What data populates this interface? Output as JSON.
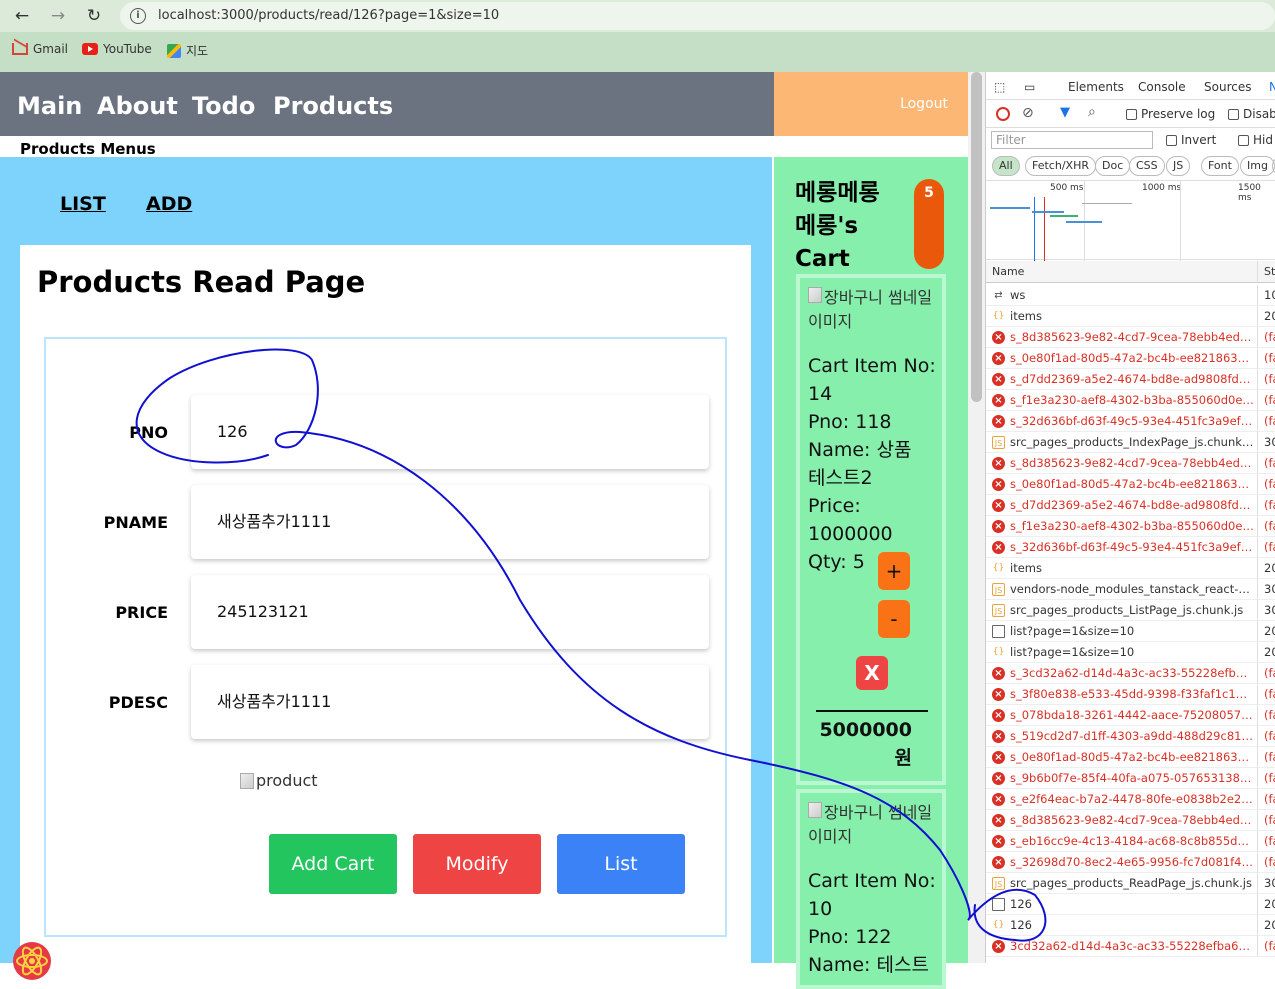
{
  "browser": {
    "url": "localhost:3000/products/read/126?page=1&size=10",
    "bookmarks": [
      "Gmail",
      "YouTube",
      "지도"
    ]
  },
  "app": {
    "nav": [
      "Main",
      "About",
      "Todo",
      "Products"
    ],
    "logout": "Logout",
    "menu_title": "Products Menus",
    "tabs": [
      "LIST",
      "ADD"
    ],
    "page_title": "Products Read Page",
    "fields": [
      {
        "label": "PNO",
        "value": "126"
      },
      {
        "label": "PNAME",
        "value": "새상품추가1111"
      },
      {
        "label": "PRICE",
        "value": "245123121"
      },
      {
        "label": "PDESC",
        "value": "새상품추가1111"
      }
    ],
    "product_image_alt": "product",
    "buttons": {
      "add_cart": "Add Cart",
      "modify": "Modify",
      "list": "List"
    }
  },
  "cart": {
    "title": "메롱메롱메롱's Cart",
    "count": "5",
    "items": [
      {
        "image_alt": "장바구니 썸네일 이미지",
        "cino_label": "Cart Item No:",
        "cino": "14",
        "pno": "Pno: 118",
        "name_label": "Name: 상품",
        "name_rest": "테스트2",
        "price_label": "Price:",
        "price": "1000000",
        "qty": "Qty: 5",
        "plus": "+",
        "minus": "-",
        "remove": "X",
        "total": "5000000",
        "currency": "원"
      },
      {
        "image_alt": "장바구니 썸네일 이미지",
        "cino_label": "Cart Item No:",
        "cino": "10",
        "pno": "Pno: 122",
        "name_label": "Name: 테스트"
      }
    ]
  },
  "devtools": {
    "tabs": [
      "Elements",
      "Console",
      "Sources",
      "N"
    ],
    "preserve_log": "Preserve log",
    "disable": "Disab",
    "filter_placeholder": "Filter",
    "invert": "Invert",
    "hide": "Hid",
    "filters": [
      "All",
      "Fetch/XHR",
      "Doc",
      "CSS",
      "JS",
      "Font",
      "Img",
      "M"
    ],
    "timeline_labels": [
      "500 ms",
      "1000 ms",
      "1500 ms"
    ],
    "col_name": "Name",
    "col_status": "Sta",
    "rows": [
      {
        "type": "ws",
        "name": "ws",
        "status": "10"
      },
      {
        "type": "xhr",
        "name": "items",
        "status": "20"
      },
      {
        "type": "err",
        "name": "s_8d385623-9e82-4cd7-9cea-78ebb4ed1ef5...",
        "status": "(fa"
      },
      {
        "type": "err",
        "name": "s_0e80f1ad-80d5-47a2-bc4b-ee8218639624...",
        "status": "(fa"
      },
      {
        "type": "err",
        "name": "s_d7dd2369-a5e2-4674-bd8e-ad9808fd0f87...",
        "status": "(fa"
      },
      {
        "type": "err",
        "name": "s_f1e3a230-aef8-4302-b3ba-855060d0e709...",
        "status": "(fa"
      },
      {
        "type": "err",
        "name": "s_32d636bf-d63f-49c5-93e4-451fc3a9efc1_l...",
        "status": "(fa"
      },
      {
        "type": "js",
        "name": "src_pages_products_IndexPage_js.chunk.js",
        "status": "30"
      },
      {
        "type": "err",
        "name": "s_8d385623-9e82-4cd7-9cea-78ebb4ed1ef5...",
        "status": "(fa"
      },
      {
        "type": "err",
        "name": "s_0e80f1ad-80d5-47a2-bc4b-ee8218639624...",
        "status": "(fa"
      },
      {
        "type": "err",
        "name": "s_d7dd2369-a5e2-4674-bd8e-ad9808fd0f87...",
        "status": "(fa"
      },
      {
        "type": "err",
        "name": "s_f1e3a230-aef8-4302-b3ba-855060d0e709...",
        "status": "(fa"
      },
      {
        "type": "err",
        "name": "s_32d636bf-d63f-49c5-93e4-451fc3a9efc1_l...",
        "status": "(fa"
      },
      {
        "type": "xhr",
        "name": "items",
        "status": "20"
      },
      {
        "type": "js",
        "name": "vendors-node_modules_tanstack_react-quer...",
        "status": "30"
      },
      {
        "type": "js",
        "name": "src_pages_products_ListPage_js.chunk.js",
        "status": "30"
      },
      {
        "type": "doc",
        "name": "list?page=1&size=10",
        "status": "20"
      },
      {
        "type": "xhr",
        "name": "list?page=1&size=10",
        "status": "20"
      },
      {
        "type": "err",
        "name": "s_3cd32a62-d14d-4a3c-ac33-55228efba612...",
        "status": "(fa"
      },
      {
        "type": "err",
        "name": "s_3f80e838-e533-45dd-9398-f33faf1c171d_r...",
        "status": "(fa"
      },
      {
        "type": "err",
        "name": "s_078bda18-3261-4442-aace-752080571117...",
        "status": "(fa"
      },
      {
        "type": "err",
        "name": "s_519cd2d7-d1ff-4303-a9dd-488d29c81e99...",
        "status": "(fa"
      },
      {
        "type": "err",
        "name": "s_0e80f1ad-80d5-47a2-bc4b-ee8218639624...",
        "status": "(fa"
      },
      {
        "type": "err",
        "name": "s_9b6b0f7e-85f4-40fa-a075-0576531385ef_...",
        "status": "(fa"
      },
      {
        "type": "err",
        "name": "s_e2f64eac-b7a2-4478-80fe-e0838b2e2f9e_...",
        "status": "(fa"
      },
      {
        "type": "err",
        "name": "s_8d385623-9e82-4cd7-9cea-78ebb4ed1ef5...",
        "status": "(fa"
      },
      {
        "type": "err",
        "name": "s_eb16cc9e-4c13-4184-ac68-8c8b855dce0b...",
        "status": "(fa"
      },
      {
        "type": "err",
        "name": "s_32698d70-8ec2-4e65-9956-fc7d081f454b_...",
        "status": "(fa"
      },
      {
        "type": "js",
        "name": "src_pages_products_ReadPage_js.chunk.js",
        "status": "30"
      },
      {
        "type": "doc",
        "name": "126",
        "status": "20"
      },
      {
        "type": "xhr",
        "name": "126",
        "status": "20"
      },
      {
        "type": "err",
        "name": "3cd32a62-d14d-4a3c-ac33-55228efba612_b...",
        "status": "(fa"
      }
    ]
  }
}
